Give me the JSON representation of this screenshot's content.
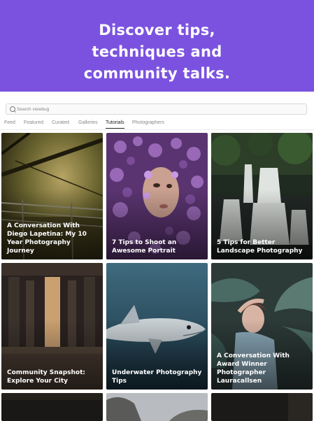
{
  "banner": {
    "line1": "Discover tips,",
    "line2": "techniques and",
    "line3": "community talks.",
    "bg_color": "#7b52e0"
  },
  "search": {
    "placeholder": "Search viewbug"
  },
  "tabs": [
    {
      "label": "Feed"
    },
    {
      "label": "Featured"
    },
    {
      "label": "Curated"
    },
    {
      "label": "Galleries"
    },
    {
      "label": "Tutorials",
      "active": true
    },
    {
      "label": "Photographers"
    }
  ],
  "cards": [
    {
      "title": "A Conversation With Diego Lapetina: My 10 Year Photography Journey",
      "image": "fence-sunset-photo"
    },
    {
      "title": "7 Tips to Shoot an Awesome Portrait",
      "image": "flower-portrait-photo"
    },
    {
      "title": "5 Tips for Better Landscape Photography",
      "image": "waterfall-photo"
    },
    {
      "title": "Community Snapshot: Explore Your City",
      "image": "bridge-city-photo"
    },
    {
      "title": "Underwater Photography Tips",
      "image": "shark-photo"
    },
    {
      "title": "A Conversation With Award Winner Photographer Lauracallsen",
      "image": "woman-plants-photo"
    }
  ]
}
